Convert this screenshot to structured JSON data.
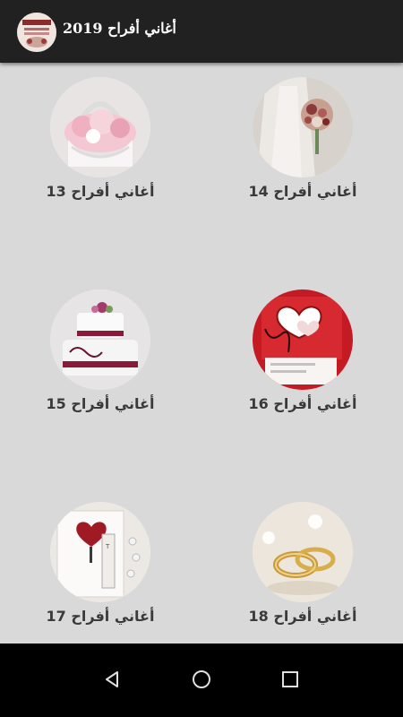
{
  "app": {
    "title": "أغاني أفراح 2019"
  },
  "tiles": [
    {
      "label": "أغاني أفراح 13",
      "icon": "flower-basket-image"
    },
    {
      "label": "أغاني أفراح 14",
      "icon": "bridal-bouquet-image"
    },
    {
      "label": "أغاني أفراح 15",
      "icon": "wedding-cake-image"
    },
    {
      "label": "أغاني أفراح 16",
      "icon": "heart-card-image"
    },
    {
      "label": "أغاني أفراح 17",
      "icon": "invitation-card-image"
    },
    {
      "label": "أغاني أفراح 18",
      "icon": "wedding-rings-image"
    }
  ],
  "navigation": {
    "back": "back-icon",
    "home": "home-icon",
    "recents": "recents-icon"
  },
  "colors": {
    "appbar": "#212121",
    "background": "#d9d9d9",
    "navbar": "#000000",
    "label": "#3a3a3a"
  }
}
